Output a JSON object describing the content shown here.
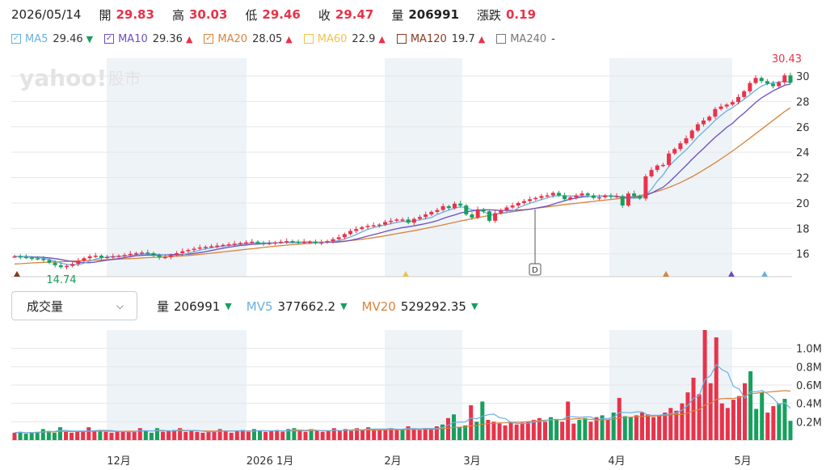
{
  "header": {
    "date": "2026/05/14",
    "open_label": "開",
    "open_value": "29.83",
    "high_label": "高",
    "high_value": "30.03",
    "low_label": "低",
    "low_value": "29.46",
    "close_label": "收",
    "close_value": "29.47",
    "volume_label": "量",
    "volume_value": "206991",
    "change_label": "漲跌",
    "change_value": "0.19"
  },
  "ma_legend": [
    {
      "name": "MA5",
      "value": "29.46",
      "trend": "down",
      "color": "#6ab0e2",
      "checked": true
    },
    {
      "name": "MA10",
      "value": "29.36",
      "trend": "up",
      "color": "#6b4fbf",
      "checked": true
    },
    {
      "name": "MA20",
      "value": "28.05",
      "trend": "up",
      "color": "#d9833b",
      "checked": true
    },
    {
      "name": "MA60",
      "value": "22.9",
      "trend": "up",
      "color": "#f0c24a",
      "checked": false
    },
    {
      "name": "MA120",
      "value": "19.7",
      "trend": "up",
      "color": "#8a3a1d",
      "checked": false
    },
    {
      "name": "MA240",
      "value": "-",
      "trend": "none",
      "color": "#777777",
      "checked": false
    }
  ],
  "watermark": {
    "brand": "yahoo!",
    "sub": "股市"
  },
  "colors": {
    "up": "#e8334a",
    "down": "#17a05d",
    "shade": "#eef3f8",
    "grid": "#e6e6e6"
  },
  "chart_data": [
    {
      "type": "candlestick",
      "title": "",
      "y_ticks": [
        "16",
        "18",
        "20",
        "22",
        "24",
        "26",
        "28",
        "30"
      ],
      "ylim": [
        14.2,
        31.4
      ],
      "max_label": "30.43",
      "min_label": "14.74",
      "event_marker": "D",
      "x_tick_labels": [
        "12月",
        "2026 1月",
        "2月",
        "3月",
        "4月",
        "5月"
      ],
      "closes": [
        15.8,
        15.75,
        15.7,
        15.65,
        15.6,
        15.5,
        15.3,
        15.1,
        14.95,
        15.05,
        15.2,
        15.45,
        15.65,
        15.8,
        15.85,
        15.7,
        15.75,
        15.8,
        15.85,
        15.9,
        16.0,
        16.05,
        16.1,
        16.05,
        15.85,
        15.7,
        15.75,
        15.9,
        16.05,
        16.2,
        16.3,
        16.4,
        16.5,
        16.55,
        16.6,
        16.65,
        16.7,
        16.75,
        16.8,
        16.85,
        16.9,
        16.95,
        16.85,
        16.8,
        16.85,
        16.9,
        16.95,
        17.0,
        16.95,
        16.9,
        16.95,
        16.95,
        16.85,
        16.9,
        17.0,
        17.15,
        17.3,
        17.55,
        17.8,
        17.95,
        18.1,
        18.2,
        18.25,
        18.3,
        18.5,
        18.6,
        18.7,
        18.7,
        18.45,
        18.75,
        18.9,
        19.1,
        19.3,
        19.45,
        19.75,
        19.6,
        19.95,
        19.8,
        19.1,
        18.85,
        19.5,
        19.35,
        18.6,
        19.2,
        19.45,
        19.65,
        19.8,
        20.0,
        20.15,
        20.3,
        20.4,
        20.55,
        20.6,
        20.8,
        20.6,
        20.3,
        20.45,
        20.6,
        20.75,
        20.6,
        20.4,
        20.45,
        20.6,
        20.5,
        20.55,
        19.8,
        20.75,
        20.55,
        20.35,
        22.1,
        22.6,
        22.95,
        23.0,
        23.9,
        24.25,
        24.7,
        25.1,
        25.7,
        26.2,
        26.5,
        26.8,
        27.4,
        27.6,
        27.75,
        27.95,
        28.35,
        28.8,
        29.45,
        29.85,
        29.6,
        29.4,
        29.2,
        29.5,
        30.05,
        29.47
      ],
      "ma5": [
        15.8,
        15.78,
        15.75,
        15.72,
        15.7,
        15.64,
        15.55,
        15.42,
        15.27,
        15.17,
        15.12,
        15.15,
        15.26,
        15.43,
        15.59,
        15.69,
        15.75,
        15.78,
        15.79,
        15.82,
        15.86,
        15.92,
        15.98,
        16.0,
        15.97,
        15.95,
        15.9,
        15.87,
        15.87,
        15.92,
        16.04,
        16.17,
        16.29,
        16.39,
        16.47,
        16.54,
        16.6,
        16.65,
        16.7,
        16.75,
        16.8,
        16.85,
        16.85,
        16.85,
        16.87,
        16.87,
        16.87,
        16.9,
        16.93,
        16.92,
        16.93,
        16.95,
        16.92,
        16.91,
        16.93,
        16.97,
        17.04,
        17.16,
        17.32,
        17.52,
        17.73,
        17.92,
        18.06,
        18.16,
        18.27,
        18.37,
        18.47,
        18.55,
        18.55,
        18.58,
        18.68,
        18.77,
        18.86,
        19.1,
        19.27,
        19.44,
        19.59,
        19.71,
        19.64,
        19.46,
        19.44,
        19.32,
        19.08,
        19.1,
        19.22,
        19.27,
        19.34,
        19.62,
        19.81,
        19.98,
        20.12,
        20.28,
        20.4,
        20.53,
        20.59,
        20.57,
        20.55,
        20.55,
        20.54,
        20.54,
        20.52,
        20.56,
        20.57,
        20.52,
        20.51,
        20.38,
        20.37,
        20.38,
        20.4,
        20.61,
        21.08,
        21.72,
        22.21,
        22.89,
        23.35,
        23.78,
        24.19,
        24.67,
        25.2,
        25.62,
        26.05,
        26.52,
        26.9,
        27.25,
        27.51,
        27.86,
        28.17,
        28.52,
        28.89,
        29.2,
        29.38,
        29.47,
        29.52,
        29.62,
        29.46
      ],
      "ma10": [
        15.8,
        15.79,
        15.78,
        15.76,
        15.74,
        15.72,
        15.68,
        15.62,
        15.55,
        15.47,
        15.4,
        15.34,
        15.3,
        15.3,
        15.35,
        15.43,
        15.5,
        15.56,
        15.62,
        15.69,
        15.77,
        15.85,
        15.88,
        15.9,
        15.9,
        15.9,
        15.91,
        15.93,
        15.95,
        15.95,
        15.97,
        16.02,
        16.09,
        16.17,
        16.26,
        16.35,
        16.44,
        16.52,
        16.59,
        16.65,
        16.7,
        16.74,
        16.77,
        16.8,
        16.82,
        16.85,
        16.87,
        16.88,
        16.89,
        16.9,
        16.91,
        16.93,
        16.92,
        16.91,
        16.91,
        16.91,
        16.93,
        16.98,
        17.06,
        17.16,
        17.27,
        17.39,
        17.51,
        17.63,
        17.75,
        17.87,
        17.98,
        18.07,
        18.13,
        18.2,
        18.29,
        18.38,
        18.49,
        18.61,
        18.78,
        18.93,
        19.06,
        19.21,
        19.31,
        19.37,
        19.43,
        19.47,
        19.46,
        19.44,
        19.42,
        19.42,
        19.41,
        19.45,
        19.47,
        19.51,
        19.59,
        19.68,
        19.77,
        19.9,
        20.05,
        20.18,
        20.3,
        20.39,
        20.47,
        20.51,
        20.53,
        20.54,
        20.55,
        20.55,
        20.54,
        20.45,
        20.48,
        20.47,
        20.44,
        20.59,
        20.79,
        21.02,
        21.24,
        21.62,
        22.06,
        22.52,
        22.96,
        23.44,
        23.88,
        24.3,
        24.75,
        25.18,
        25.56,
        25.96,
        26.28,
        26.71,
        27.09,
        27.51,
        27.92,
        28.28,
        28.55,
        28.83,
        29.05,
        29.27,
        29.36
      ],
      "ma20": [
        15.2,
        15.22,
        15.25,
        15.28,
        15.3,
        15.32,
        15.34,
        15.36,
        15.38,
        15.4,
        15.42,
        15.44,
        15.46,
        15.48,
        15.5,
        15.52,
        15.54,
        15.56,
        15.58,
        15.6,
        15.62,
        15.64,
        15.67,
        15.7,
        15.72,
        15.74,
        15.76,
        15.78,
        15.81,
        15.84,
        15.87,
        15.91,
        15.95,
        16.0,
        16.05,
        16.1,
        16.15,
        16.2,
        16.25,
        16.3,
        16.35,
        16.4,
        16.45,
        16.5,
        16.55,
        16.6,
        16.64,
        16.68,
        16.72,
        16.76,
        16.79,
        16.82,
        16.85,
        16.88,
        16.91,
        16.94,
        16.97,
        17.0,
        17.04,
        17.09,
        17.14,
        17.2,
        17.27,
        17.34,
        17.42,
        17.5,
        17.58,
        17.66,
        17.74,
        17.82,
        17.91,
        18.0,
        18.09,
        18.18,
        18.28,
        18.38,
        18.48,
        18.58,
        18.67,
        18.76,
        18.85,
        18.94,
        19.02,
        19.1,
        19.17,
        19.24,
        19.31,
        19.38,
        19.45,
        19.52,
        19.58,
        19.64,
        19.7,
        19.76,
        19.82,
        19.88,
        19.93,
        19.98,
        20.03,
        20.08,
        20.13,
        20.18,
        20.23,
        20.28,
        20.33,
        20.38,
        20.43,
        20.5,
        20.58,
        20.68,
        20.79,
        20.92,
        21.06,
        21.23,
        21.41,
        21.61,
        21.83,
        22.07,
        22.33,
        22.6,
        22.88,
        23.17,
        23.47,
        23.78,
        24.1,
        24.43,
        24.77,
        25.11,
        25.46,
        25.81,
        26.16,
        26.51,
        26.86,
        27.2,
        27.5
      ]
    },
    {
      "type": "bar",
      "title": "",
      "series_name": "量",
      "y_ticks": [
        "0.2M",
        "0.4M",
        "0.6M",
        "0.8M",
        "1.0M"
      ],
      "ylim": [
        0,
        1.2
      ],
      "x_tick_labels": [
        "12月",
        "2026 1月",
        "2月",
        "3月",
        "4月",
        "5月"
      ],
      "values": [
        0.08,
        0.09,
        0.07,
        0.08,
        0.09,
        0.12,
        0.1,
        0.08,
        0.14,
        0.09,
        0.08,
        0.1,
        0.09,
        0.14,
        0.1,
        0.11,
        0.09,
        0.08,
        0.1,
        0.09,
        0.1,
        0.09,
        0.13,
        0.1,
        0.08,
        0.13,
        0.09,
        0.1,
        0.11,
        0.13,
        0.09,
        0.1,
        0.09,
        0.08,
        0.09,
        0.1,
        0.12,
        0.1,
        0.08,
        0.1,
        0.11,
        0.09,
        0.12,
        0.1,
        0.09,
        0.1,
        0.11,
        0.09,
        0.12,
        0.13,
        0.1,
        0.09,
        0.12,
        0.1,
        0.09,
        0.1,
        0.13,
        0.1,
        0.12,
        0.1,
        0.13,
        0.11,
        0.14,
        0.12,
        0.11,
        0.12,
        0.13,
        0.11,
        0.12,
        0.15,
        0.12,
        0.11,
        0.13,
        0.12,
        0.15,
        0.17,
        0.24,
        0.28,
        0.14,
        0.16,
        0.38,
        0.2,
        0.42,
        0.22,
        0.2,
        0.18,
        0.16,
        0.2,
        0.17,
        0.19,
        0.2,
        0.22,
        0.24,
        0.2,
        0.25,
        0.22,
        0.2,
        0.42,
        0.18,
        0.22,
        0.24,
        0.2,
        0.25,
        0.27,
        0.22,
        0.3,
        0.46,
        0.26,
        0.25,
        0.27,
        0.3,
        0.28,
        0.25,
        0.26,
        0.3,
        0.35,
        0.32,
        0.4,
        0.52,
        0.68,
        0.5,
        1.2,
        0.62,
        1.12,
        0.4,
        0.35,
        0.44,
        0.48,
        0.62,
        0.75,
        0.34,
        0.52,
        0.3,
        0.37,
        0.4,
        0.45,
        0.21
      ],
      "mv5_label": "MV5",
      "mv5_value": "377662.2",
      "mv5_trend": "down",
      "mv20_label": "MV20",
      "mv20_value": "529292.35",
      "mv20_trend": "down"
    }
  ],
  "selector": {
    "label": "成交量"
  }
}
